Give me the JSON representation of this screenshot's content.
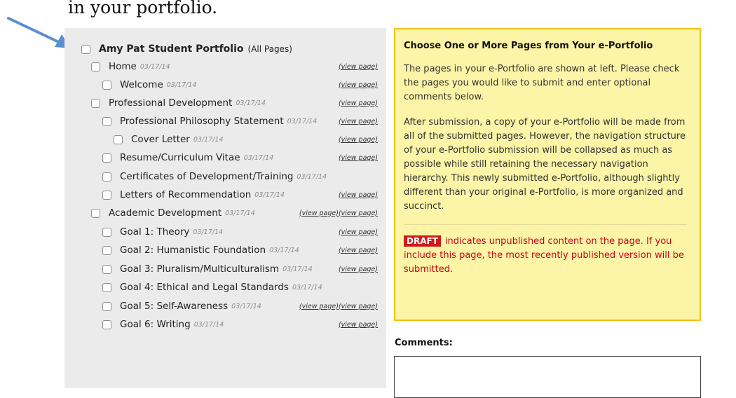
{
  "heading": {
    "text": "in your portfolio."
  },
  "tree": {
    "root": {
      "title": "Amy Pat Student Portfolio",
      "suffix": "(All Pages)"
    },
    "items": [
      {
        "title": "Home",
        "date": "03/17/14",
        "link": "(view page)"
      },
      {
        "title": "Welcome",
        "date": "03/17/14",
        "link": "(view page)"
      },
      {
        "title": "Professional Development",
        "date": "03/17/14",
        "link": "(view page)"
      },
      {
        "title": "Professional Philosophy Statement",
        "date": "03/17/14",
        "link": "(view page)"
      },
      {
        "title": "Cover Letter",
        "date": "03/17/14",
        "link": "(view page)"
      },
      {
        "title": "Resume/Curriculum Vitae",
        "date": "03/17/14",
        "link": "(view page)"
      },
      {
        "title": "Certificates of Development/Training",
        "date": "03/17/14",
        "link": ""
      },
      {
        "title": "Letters of Recommendation",
        "date": "03/17/14",
        "link": "(view page)"
      },
      {
        "title": "Academic Development",
        "date": "03/17/14",
        "link": "(view page)(view page)"
      },
      {
        "title": "Goal 1: Theory",
        "date": "03/17/14",
        "link": "(view page)"
      },
      {
        "title": "Goal 2: Humanistic Foundation",
        "date": "03/17/14",
        "link": "(view page)"
      },
      {
        "title": "Goal 3: Pluralism/Multiculturalism",
        "date": "03/17/14",
        "link": "(view page)"
      },
      {
        "title": "Goal 4: Ethical and Legal Standards",
        "date": "03/17/14",
        "link": ""
      },
      {
        "title": "Goal 5: Self-Awareness",
        "date": "03/17/14",
        "link": "(view page)(view page)"
      },
      {
        "title": "Goal 6: Writing",
        "date": "03/17/14",
        "link": "(view page)"
      }
    ]
  },
  "info": {
    "title": "Choose One or More Pages from Your e-Portfolio",
    "p1": "The pages in your e-Portfolio are shown at left. Please check the pages you would like to submit and enter optional comments below.",
    "p2": "After submission, a copy of your e-Portfolio will be made from all of the submitted pages. However, the navigation structure of your e-Portfolio submission will be collapsed as much as possible while still retaining the necessary navigation hierarchy. This newly submitted e-Portfolio, although slightly different than your original e-Portfolio, is more organized and succinct.",
    "draft_badge": "DRAFT",
    "draft_text": "indicates unpublished content on the page. If you include this page, the most recently published version will be submitted."
  },
  "comments": {
    "label": "Comments:",
    "value": ""
  },
  "colors": {
    "panel_bg": "#ebebeb",
    "info_bg": "#fcf4a6",
    "info_border": "#f0c419",
    "draft_red": "#cd1a1a",
    "arrow_blue": "#5b8fd0"
  }
}
